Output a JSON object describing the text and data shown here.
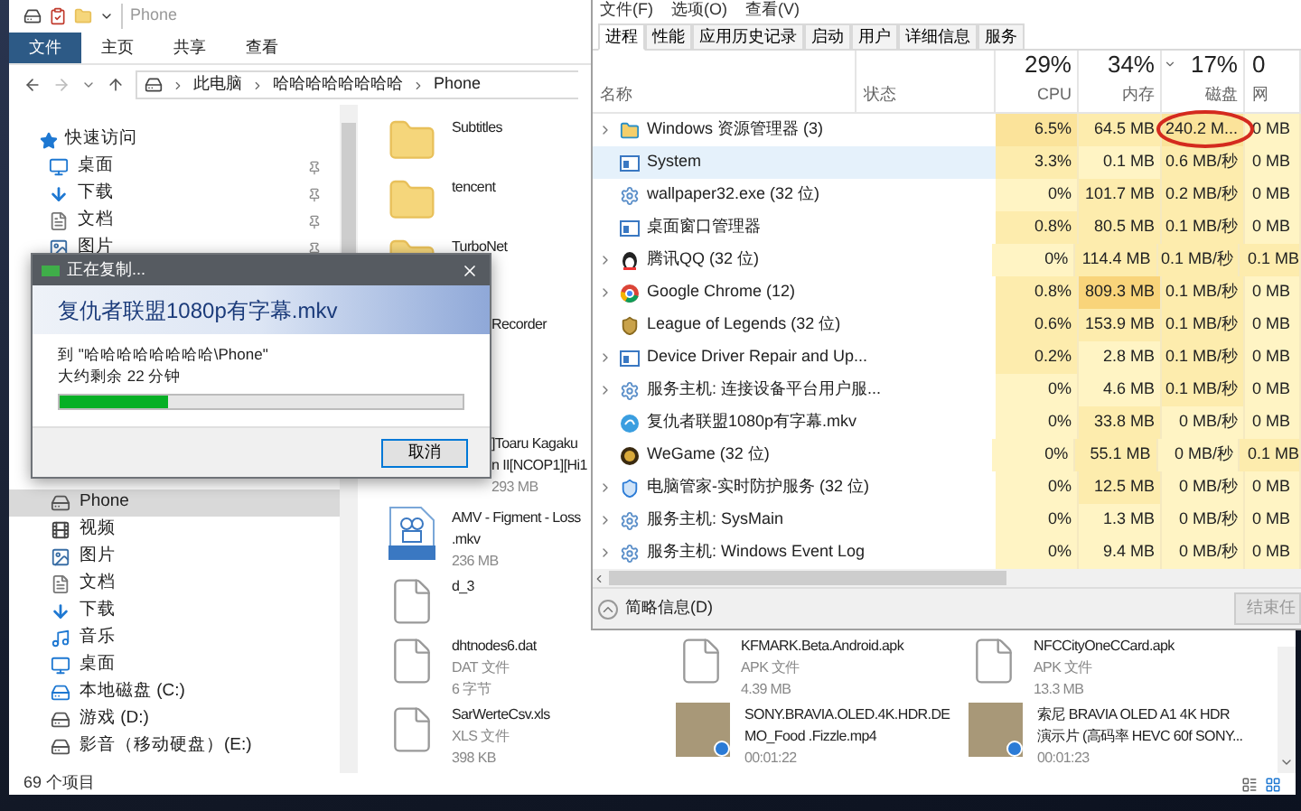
{
  "explorer": {
    "title": "Phone",
    "ribbon_tabs": [
      {
        "label": "文件",
        "kind": "file_menu",
        "selected": false
      },
      {
        "label": "主页",
        "kind": "tab",
        "selected": false
      },
      {
        "label": "共享",
        "kind": "tab",
        "selected": false
      },
      {
        "label": "查看",
        "kind": "tab",
        "selected": false
      }
    ],
    "breadcrumb": [
      "此电脑",
      "哈哈哈哈哈哈哈哈",
      "Phone"
    ],
    "sidebar": {
      "quick_access": {
        "label": "快速访问",
        "children": [
          {
            "label": "桌面",
            "kind": "desktop",
            "pinned": true,
            "selected": false
          },
          {
            "label": "下载",
            "kind": "download",
            "pinned": true,
            "selected": false
          },
          {
            "label": "文档",
            "kind": "document",
            "pinned": true,
            "selected": false
          },
          {
            "label": "图片",
            "kind": "picture",
            "pinned": true,
            "selected": false
          }
        ]
      },
      "items": [
        {
          "label": "Phone",
          "kind": "drive",
          "selected": true
        },
        {
          "label": "视频",
          "kind": "video",
          "selected": false
        },
        {
          "label": "图片",
          "kind": "picture",
          "selected": false
        },
        {
          "label": "文档",
          "kind": "document",
          "selected": false
        },
        {
          "label": "下载",
          "kind": "download",
          "selected": false
        },
        {
          "label": "音乐",
          "kind": "music",
          "selected": false
        },
        {
          "label": "桌面",
          "kind": "desktop",
          "selected": false
        },
        {
          "label": "本地磁盘 (C:)",
          "kind": "system_disk",
          "selected": false
        },
        {
          "label": "游戏 (D:)",
          "kind": "drive",
          "selected": false
        },
        {
          "label": "影音（移动硬盘）(E:)",
          "kind": "drive",
          "selected": false
        }
      ]
    },
    "file_rows": [
      {
        "cells": [
          {
            "kind": "folder",
            "name": [
              "Subtitles"
            ]
          }
        ]
      },
      {
        "cells": [
          {
            "kind": "folder",
            "name": [
              "tencent"
            ]
          }
        ]
      },
      {
        "cells": [
          {
            "kind": "folder",
            "name": [
              "TurboNet"
            ]
          }
        ]
      },
      {
        "cells": [
          {
            "kind": "covered",
            "name": [
              "Recorder"
            ]
          }
        ]
      },
      {
        "cells": [
          {
            "kind": "covered",
            "name": [
              "]Toaru Kagaku",
              "n II[NCOP1][Hi1"
            ],
            "details": [
              "293 MB"
            ]
          }
        ]
      },
      {
        "cells": [
          {
            "kind": "mkv",
            "name": [
              "AMV - Figment - Loss",
              ".mkv"
            ],
            "details": [
              "236 MB"
            ]
          }
        ]
      },
      {
        "cells": [
          {
            "kind": "file",
            "name": [
              "d_3"
            ]
          }
        ]
      },
      {
        "cells": [
          {
            "kind": "file",
            "name": [
              "dhtnodes6.dat"
            ],
            "details": [
              "DAT 文件",
              "6 字节"
            ]
          },
          {
            "kind": "file",
            "name": [
              "KFMARK.Beta.Android.apk"
            ],
            "details": [
              "APK 文件",
              "4.39 MB"
            ]
          },
          {
            "kind": "file",
            "name": [
              "NFCCityOneCCard.apk"
            ],
            "details": [
              "APK 文件",
              "13.3 MB"
            ]
          }
        ]
      },
      {
        "cells": [
          {
            "kind": "file",
            "name": [
              "SarWerteCsv.xls"
            ],
            "details": [
              "XLS 文件",
              "398 KB"
            ]
          },
          {
            "kind": "video_thumb",
            "name": [
              "SONY.BRAVIA.OLED.4K.HDR.DE",
              "MO_Food .Fizzle.mp4"
            ],
            "details": [
              "00:01:22"
            ]
          },
          {
            "kind": "video_thumb",
            "name": [
              "索尼 BRAVIA OLED A1 4K HDR",
              "演示片 (高码率 HEVC 60f SONY..."
            ],
            "details": [
              "00:01:23"
            ]
          }
        ]
      }
    ],
    "status_bar": "69 个项目"
  },
  "task_manager": {
    "menu": [
      "文件(F)",
      "选项(O)",
      "查看(V)"
    ],
    "tabs": [
      {
        "label": "进程",
        "selected": true
      },
      {
        "label": "性能",
        "selected": false
      },
      {
        "label": "应用历史记录",
        "selected": false
      },
      {
        "label": "启动",
        "selected": false
      },
      {
        "label": "用户",
        "selected": false
      },
      {
        "label": "详细信息",
        "selected": false
      },
      {
        "label": "服务",
        "selected": false
      }
    ],
    "name_header": "名称",
    "status_header": "状态",
    "metric_columns": [
      {
        "percent": "29%",
        "label": "CPU",
        "sorted": false
      },
      {
        "percent": "34%",
        "label": "内存",
        "sorted": false
      },
      {
        "percent": "17%",
        "label": "磁盘",
        "sorted": true
      },
      {
        "percent": "0",
        "label": "网",
        "sorted": false
      }
    ],
    "rows": [
      {
        "name": "Windows 资源管理器 (3)",
        "kind": "explorer",
        "expandable": true,
        "selected": false,
        "metrics": [
          {
            "text": "6.5%",
            "color": "#fbe39a"
          },
          {
            "text": "64.5 MB",
            "color": "#fdecad"
          },
          {
            "text": "240.2 M...",
            "color": "#fbe39a"
          },
          {
            "text": "0 MB",
            "color": "#fff4c4"
          }
        ]
      },
      {
        "name": "System",
        "kind": "system",
        "expandable": false,
        "selected": true,
        "metrics": [
          {
            "text": "3.3%",
            "color": "#fdecad"
          },
          {
            "text": "0.1 MB",
            "color": "#fff4c4"
          },
          {
            "text": "0.6 MB/秒",
            "color": "#fdecad"
          },
          {
            "text": "0 MB",
            "color": "#fff4c4"
          }
        ]
      },
      {
        "name": "wallpaper32.exe (32 位)",
        "kind": "gear",
        "expandable": false,
        "selected": false,
        "metrics": [
          {
            "text": "0%",
            "color": "#fff4c4"
          },
          {
            "text": "101.7 MB",
            "color": "#fdecad"
          },
          {
            "text": "0.2 MB/秒",
            "color": "#fdecad"
          },
          {
            "text": "0 MB",
            "color": "#fff4c4"
          }
        ]
      },
      {
        "name": "桌面窗口管理器",
        "kind": "system",
        "expandable": false,
        "selected": false,
        "metrics": [
          {
            "text": "0.8%",
            "color": "#fdecad"
          },
          {
            "text": "80.5 MB",
            "color": "#fdecad"
          },
          {
            "text": "0.1 MB/秒",
            "color": "#fdecad"
          },
          {
            "text": "0 MB",
            "color": "#fff4c4"
          }
        ]
      },
      {
        "name": "腾讯QQ (32 位)",
        "kind": "penguin",
        "expandable": true,
        "selected": false,
        "metrics": [
          {
            "text": "0%",
            "color": "#fff4c4"
          },
          {
            "text": "114.4 MB",
            "color": "#fdecad"
          },
          {
            "text": "0.1 MB/秒",
            "color": "#fdecad"
          },
          {
            "text": "0.1 MB",
            "color": "#fdecad"
          }
        ]
      },
      {
        "name": "Google Chrome (12)",
        "kind": "chrome",
        "expandable": true,
        "selected": false,
        "metrics": [
          {
            "text": "0.8%",
            "color": "#fdecad"
          },
          {
            "text": "809.3 MB",
            "color": "#f9d47a"
          },
          {
            "text": "0.1 MB/秒",
            "color": "#fdecad"
          },
          {
            "text": "0 MB",
            "color": "#fff4c4"
          }
        ]
      },
      {
        "name": "League of Legends (32 位)",
        "kind": "game",
        "expandable": false,
        "selected": false,
        "metrics": [
          {
            "text": "0.6%",
            "color": "#fdecad"
          },
          {
            "text": "153.9 MB",
            "color": "#fdecad"
          },
          {
            "text": "0.1 MB/秒",
            "color": "#fdecad"
          },
          {
            "text": "0 MB",
            "color": "#fff4c4"
          }
        ]
      },
      {
        "name": "Device Driver Repair and Up...",
        "kind": "system",
        "expandable": true,
        "selected": false,
        "metrics": [
          {
            "text": "0.2%",
            "color": "#fdecad"
          },
          {
            "text": "2.8 MB",
            "color": "#fff4c4"
          },
          {
            "text": "0.1 MB/秒",
            "color": "#fdecad"
          },
          {
            "text": "0 MB",
            "color": "#fff4c4"
          }
        ]
      },
      {
        "name": "服务主机: 连接设备平台用户服...",
        "kind": "gear",
        "expandable": true,
        "selected": false,
        "metrics": [
          {
            "text": "0%",
            "color": "#fff4c4"
          },
          {
            "text": "4.6 MB",
            "color": "#fff4c4"
          },
          {
            "text": "0.1 MB/秒",
            "color": "#fdecad"
          },
          {
            "text": "0 MB",
            "color": "#fff4c4"
          }
        ]
      },
      {
        "name": "复仇者联盟1080p有字幕.mkv",
        "kind": "player",
        "expandable": false,
        "selected": false,
        "metrics": [
          {
            "text": "0%",
            "color": "#fff4c4"
          },
          {
            "text": "33.8 MB",
            "color": "#fdecad"
          },
          {
            "text": "0 MB/秒",
            "color": "#fff4c4"
          },
          {
            "text": "0 MB",
            "color": "#fff4c4"
          }
        ]
      },
      {
        "name": "WeGame (32 位)",
        "kind": "wegame",
        "expandable": false,
        "selected": false,
        "metrics": [
          {
            "text": "0%",
            "color": "#fff4c4"
          },
          {
            "text": "55.1 MB",
            "color": "#fdecad"
          },
          {
            "text": "0 MB/秒",
            "color": "#fff4c4"
          },
          {
            "text": "0.1 MB",
            "color": "#fdecad"
          }
        ]
      },
      {
        "name": "电脑管家-实时防护服务 (32 位)",
        "kind": "shield",
        "expandable": true,
        "selected": false,
        "metrics": [
          {
            "text": "0%",
            "color": "#fff4c4"
          },
          {
            "text": "12.5 MB",
            "color": "#fdecad"
          },
          {
            "text": "0 MB/秒",
            "color": "#fff4c4"
          },
          {
            "text": "0 MB",
            "color": "#fff4c4"
          }
        ]
      },
      {
        "name": "服务主机: SysMain",
        "kind": "gear",
        "expandable": true,
        "selected": false,
        "metrics": [
          {
            "text": "0%",
            "color": "#fff4c4"
          },
          {
            "text": "1.3 MB",
            "color": "#fff4c4"
          },
          {
            "text": "0 MB/秒",
            "color": "#fff4c4"
          },
          {
            "text": "0 MB",
            "color": "#fff4c4"
          }
        ]
      },
      {
        "name": "服务主机: Windows Event Log",
        "kind": "gear",
        "expandable": true,
        "selected": false,
        "metrics": [
          {
            "text": "0%",
            "color": "#fff4c4"
          },
          {
            "text": "9.4 MB",
            "color": "#fff4c4"
          },
          {
            "text": "0 MB/秒",
            "color": "#fff4c4"
          },
          {
            "text": "0 MB",
            "color": "#fff4c4"
          }
        ]
      }
    ],
    "footer": {
      "details_toggle": "简略信息(D)",
      "end_task": "结束任",
      "end_task_disabled": true
    }
  },
  "copy_dialog": {
    "title": "正在复制...",
    "file": "复仇者联盟1080p有字幕.mkv",
    "destination": "到 \"哈哈哈哈哈哈哈哈\\Phone\"",
    "remaining": "大约剩余 22 分钟",
    "level": 0.27,
    "cancel": "取消"
  }
}
